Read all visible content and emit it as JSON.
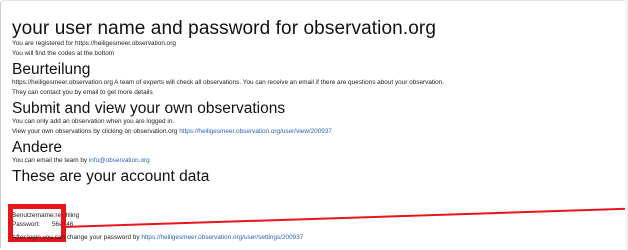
{
  "main": {
    "title": "your user name and password for observation.org",
    "intro_line1": "You are registered for https://heiligesmeer.observation.org",
    "intro_line2": "You will find the codes at the bottom",
    "beurteilung_heading": "Beurteilung",
    "beurteilung_line1": "https://heiligesmeer.observation.org A team of experts will check all observations. You can receive an email if there are questions about your observation.",
    "beurteilung_line2": "They can contact you by email to get more details",
    "submit_heading": "Submit and view your own observations",
    "submit_line1": "You can only add an observation when you are logged in.",
    "submit_line2_prefix": "View your own observations by clicking on observation.org",
    "submit_link": "https://heiligesmeer.observation.org/user/view/200937",
    "andere_heading": "Andere",
    "andere_prefix": "You can email the team by",
    "andere_email": "info@observation.org",
    "account_heading": "These are your account data"
  },
  "credentials": {
    "username_label": "Benutzername:",
    "username_value": "reichling",
    "password_label": "Passwort:",
    "password_value": "56ea46"
  },
  "footer": {
    "prefix": "After login you can change your password by",
    "link": "https://heiligesmeer.observation.org/user/settings/200937"
  },
  "colors": {
    "highlight": "#e8151b",
    "link": "#2a62b8"
  }
}
